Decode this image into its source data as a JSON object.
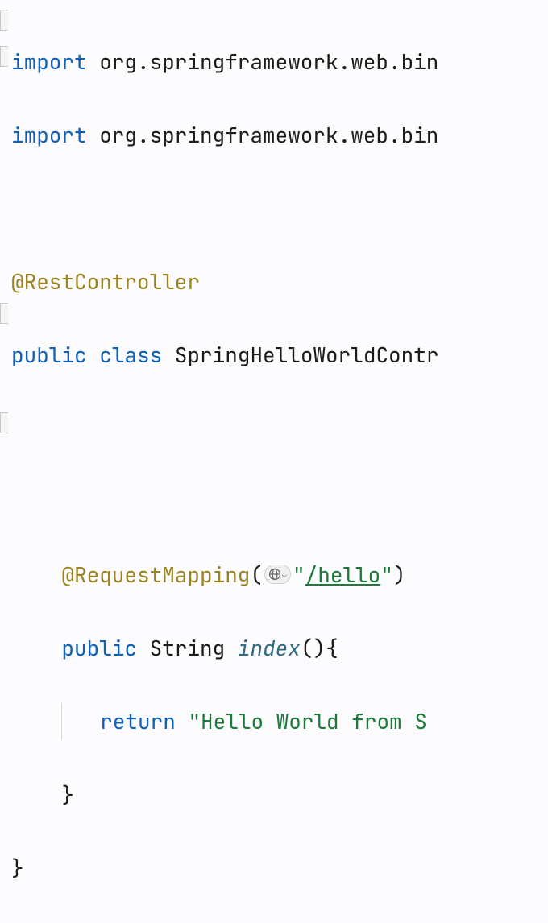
{
  "code": {
    "import_kw": "import",
    "import1_pkg": " org.springframework.web.bin",
    "import2_pkg": " org.springframework.web.bin",
    "annotation_rest": "@RestController",
    "public_kw": "public",
    "class_kw": "class",
    "class_name": "SpringHelloWorldContr",
    "annotation_req": "@RequestMapping",
    "req_open": "(",
    "req_close": ")",
    "url_q1": "\"",
    "url_path": "/hello",
    "url_q2": "\"",
    "method_public": "public",
    "method_ret": "String",
    "method_name": "index",
    "method_parens": "()",
    "method_brace": "{",
    "return_kw": "return",
    "string_lit": "\"Hello World from S",
    "close_brace_inner": "}",
    "close_brace_outer": "}"
  },
  "icons": {
    "globe": "globe-icon"
  }
}
